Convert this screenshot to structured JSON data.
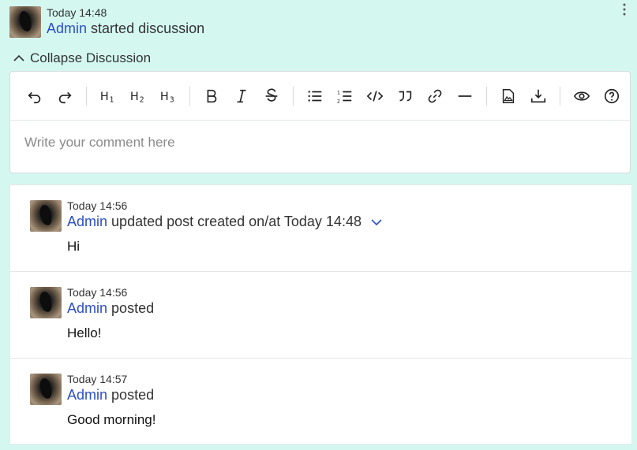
{
  "header": {
    "time": "Today 14:48",
    "user": "Admin",
    "action": "started discussion",
    "menu_icon": "more-vert-icon"
  },
  "collapse": {
    "label": "Collapse Discussion"
  },
  "editor": {
    "placeholder": "Write your comment here",
    "toolbar": {
      "h1": "H1",
      "h2": "H2",
      "h3": "H3",
      "icons": [
        "undo-icon",
        "redo-icon",
        "heading-1",
        "heading-2",
        "heading-3",
        "bold-icon",
        "italic-icon",
        "strikethrough-icon",
        "bullet-list-icon",
        "numbered-list-icon",
        "code-icon",
        "quote-icon",
        "link-icon",
        "horizontal-rule-icon",
        "insert-image-icon",
        "attach-file-icon",
        "preview-icon",
        "help-icon"
      ]
    }
  },
  "posts": [
    {
      "time": "Today 14:56",
      "user": "Admin",
      "action": "updated post created on/at Today 14:48",
      "body": "Hi"
    },
    {
      "time": "Today 14:56",
      "user": "Admin",
      "action": "posted",
      "body": "Hello!"
    },
    {
      "time": "Today 14:57",
      "user": "Admin",
      "action": "posted",
      "body": "Good morning!"
    }
  ],
  "colors": {
    "background": "#d4f8f0",
    "link": "#2d4fc4"
  }
}
